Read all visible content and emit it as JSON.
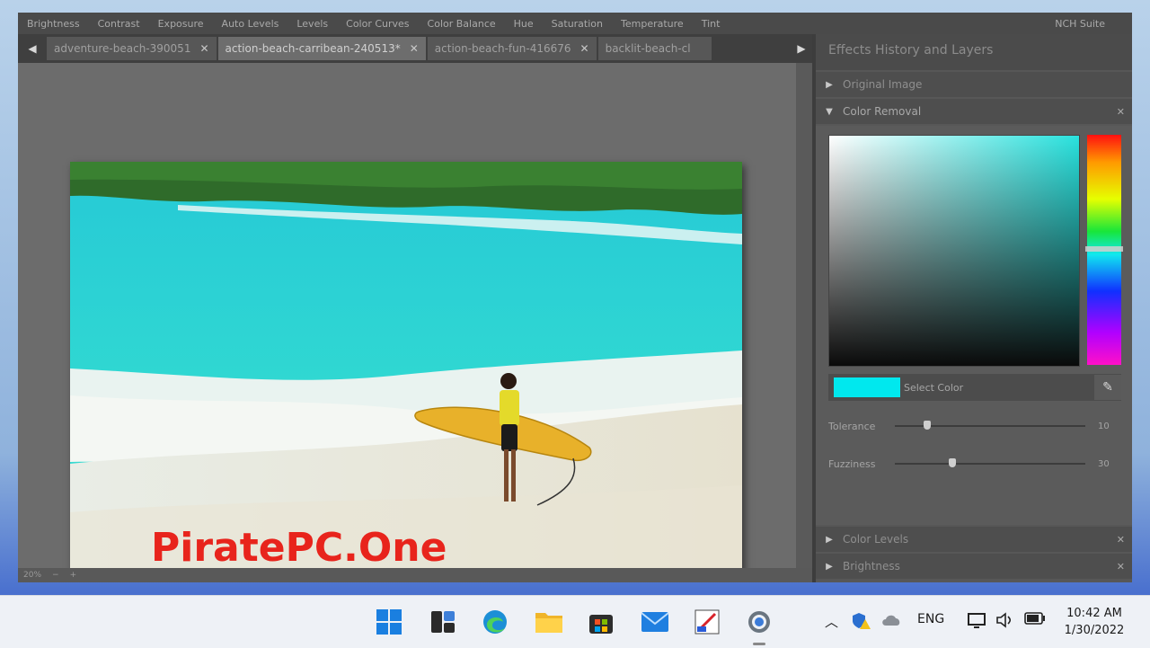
{
  "menu": [
    "Brightness",
    "Contrast",
    "Exposure",
    "Auto Levels",
    "Levels",
    "Color Curves",
    "Color Balance",
    "Hue",
    "Saturation",
    "Temperature",
    "Tint",
    "NCH Suite"
  ],
  "tabs": [
    {
      "label": "adventure-beach-390051",
      "close": "✕",
      "active": false
    },
    {
      "label": "action-beach-carribean-240513*",
      "close": "✕",
      "active": true
    },
    {
      "label": "action-beach-fun-416676",
      "close": "✕",
      "active": false
    },
    {
      "label": "backlit-beach-cl",
      "close": "",
      "active": false
    }
  ],
  "status": {
    "zoom": "20%",
    "minus": "−",
    "plus": "+"
  },
  "watermark": "PiratePC.One",
  "panel": {
    "title": "Effects History and Layers",
    "sections": {
      "original": "Original Image",
      "color_removal": "Color Removal",
      "color_levels": "Color Levels",
      "brightness": "Brightness"
    },
    "select_color_label": "Select Color",
    "selected_color": "#00e8ee",
    "tolerance_label": "Tolerance",
    "tolerance_value": "10",
    "tolerance_level": 0.17,
    "fuzziness_label": "Fuzziness",
    "fuzziness_value": "30",
    "fuzziness_level": 0.3
  },
  "taskbar": {
    "apps": [
      "windows-start-icon",
      "task-view-icon",
      "edge-icon",
      "file-explorer-icon",
      "store-icon",
      "mail-icon",
      "paint-icon",
      "settings-icon"
    ],
    "language": "ENG",
    "time": "10:42 AM",
    "date": "1/30/2022"
  }
}
